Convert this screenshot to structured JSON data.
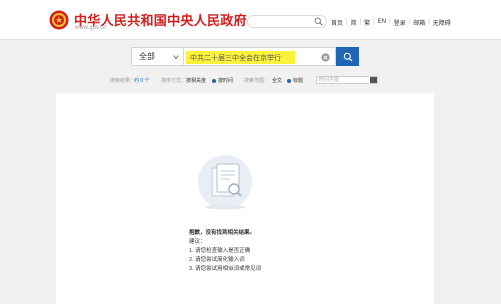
{
  "site": {
    "title": "中华人民共和国中央人民政府",
    "url": "www.gov.cn"
  },
  "top_search": {
    "placeholder": "",
    "icon": "search-icon"
  },
  "topnav": [
    {
      "label": "首页",
      "name": "nav-home"
    },
    {
      "label": "简",
      "name": "nav-simplified"
    },
    {
      "label": "繁",
      "name": "nav-traditional"
    },
    {
      "label": "EN",
      "name": "nav-english"
    },
    {
      "label": "登录",
      "name": "nav-login"
    },
    {
      "label": "邮箱",
      "name": "nav-mail"
    },
    {
      "label": "无障碍",
      "name": "nav-accessibility"
    }
  ],
  "search": {
    "scope": "全部",
    "query": "中共二十届三中全会在京举行",
    "highlight_color": "#fcf23b",
    "button_color": "#1e66b4"
  },
  "filters": {
    "result_label": "搜索结果：",
    "result_count": "约 0 个",
    "sort_label": "排序方式：",
    "sort_options": [
      "按相关度",
      "按时间"
    ],
    "sort_selected": "按时间",
    "range_label": "搜索范围：",
    "range_options": [
      "全文",
      "标题"
    ],
    "range_selected": "标题",
    "date_placeholder": "时间不限"
  },
  "empty": {
    "title": "抱歉，没有找到相关结果。",
    "suggest_label": "建议：",
    "suggestions": [
      "1. 请您检查输入是否正确",
      "2. 请您尝试简化输入词",
      "3. 请您尝试用相似词或常见词"
    ]
  },
  "colors": {
    "brand_red": "#d11f1f",
    "accent_blue": "#1e66b4"
  }
}
